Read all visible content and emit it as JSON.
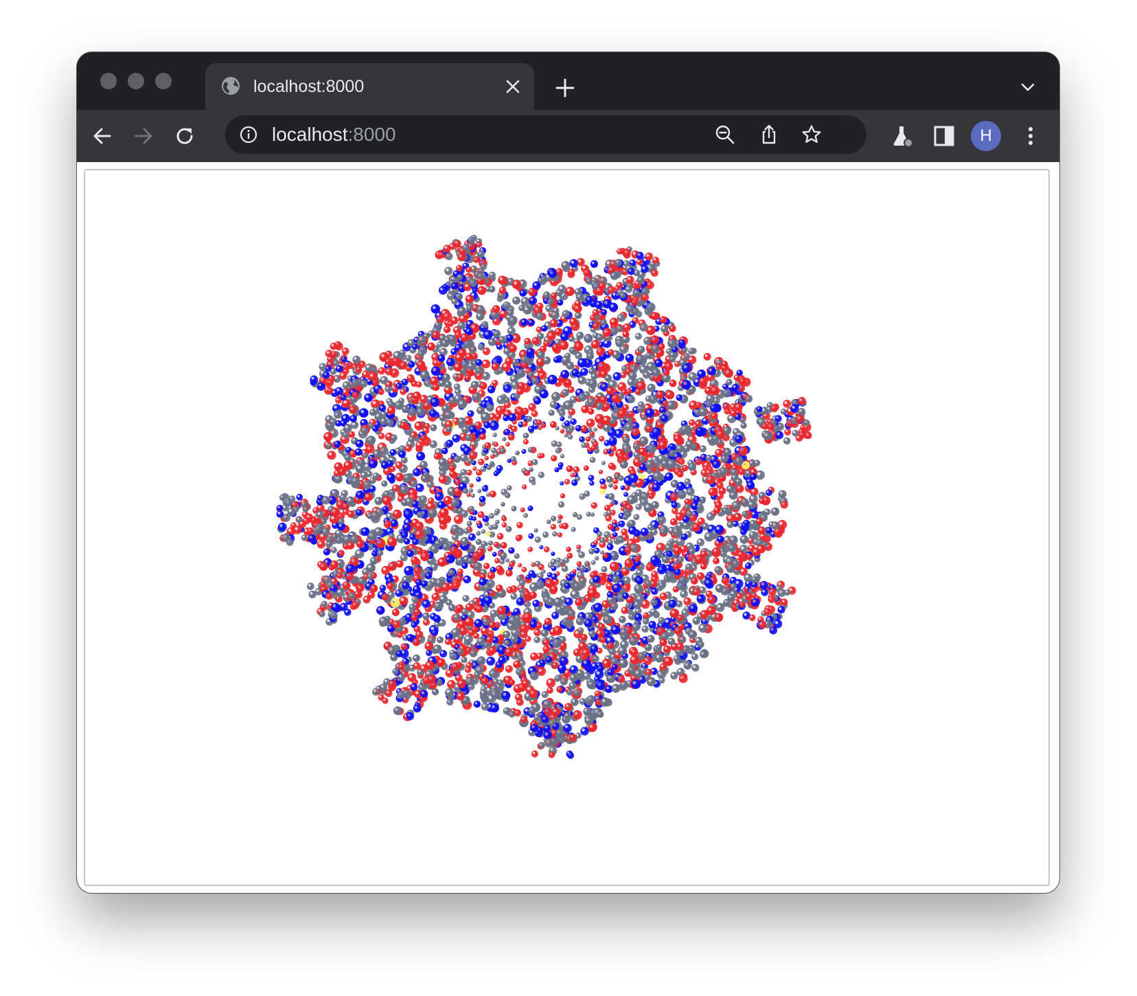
{
  "window": {
    "traffic_lights": [
      "close",
      "minimize",
      "zoom"
    ]
  },
  "tab": {
    "title": "localhost:8000",
    "favicon_icon": "globe-icon",
    "close_icon": "close-icon"
  },
  "toolbar": {
    "back_icon": "arrow-left-icon",
    "forward_icon": "arrow-right-icon",
    "reload_icon": "reload-icon",
    "url_host": "localhost",
    "url_port": ":8000",
    "site_info_icon": "info-icon",
    "zoom_icon": "zoom-out-icon",
    "share_icon": "share-icon",
    "bookmark_icon": "star-icon",
    "labs_icon": "flask-icon",
    "side_panel_icon": "side-panel-icon",
    "profile_initial": "H",
    "menu_icon": "kebab-menu-icon"
  },
  "viewer": {
    "representation": "spacefill",
    "atom_colors": {
      "carbon": "#6b7185",
      "oxygen": "#e8282e",
      "nitrogen": "#1010f0",
      "sulfur": "#f5f060"
    },
    "background": "#ffffff"
  }
}
